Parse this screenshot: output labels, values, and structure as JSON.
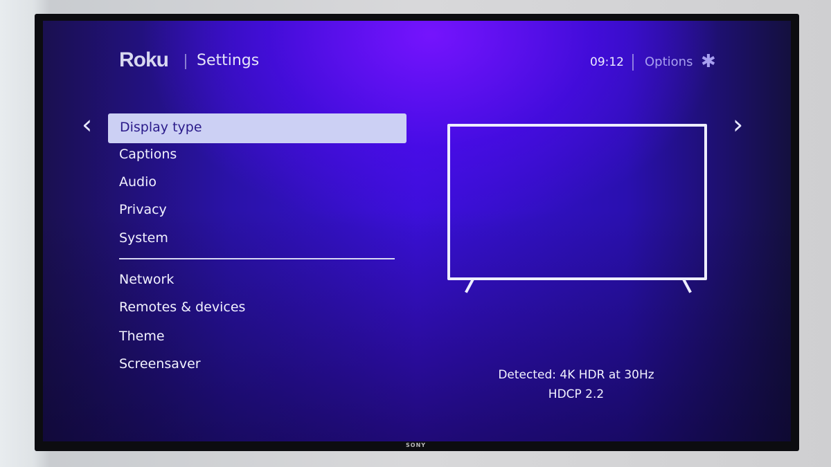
{
  "header": {
    "brand": "Roku",
    "title": "Settings",
    "time": "09:12",
    "options_label": "Options",
    "options_icon": "asterisk-icon"
  },
  "nav": {
    "left_icon": "chevron-left-icon",
    "right_icon": "chevron-right-icon"
  },
  "menu": {
    "selected": "Display type",
    "items": [
      "Display type",
      "Captions",
      "Audio",
      "Privacy",
      "System"
    ],
    "items_secondary": [
      "Network",
      "Remotes & devices",
      "Theme",
      "Screensaver"
    ]
  },
  "preview": {
    "icon": "tv-icon",
    "detected": "Detected: 4K HDR at 30Hz",
    "hdcp": "HDCP 2.2"
  },
  "tv_brand": "SONY",
  "colors": {
    "selected_bg": "#ccd0f4",
    "selected_text": "#2a1a8a",
    "background": "#3a10d8"
  }
}
